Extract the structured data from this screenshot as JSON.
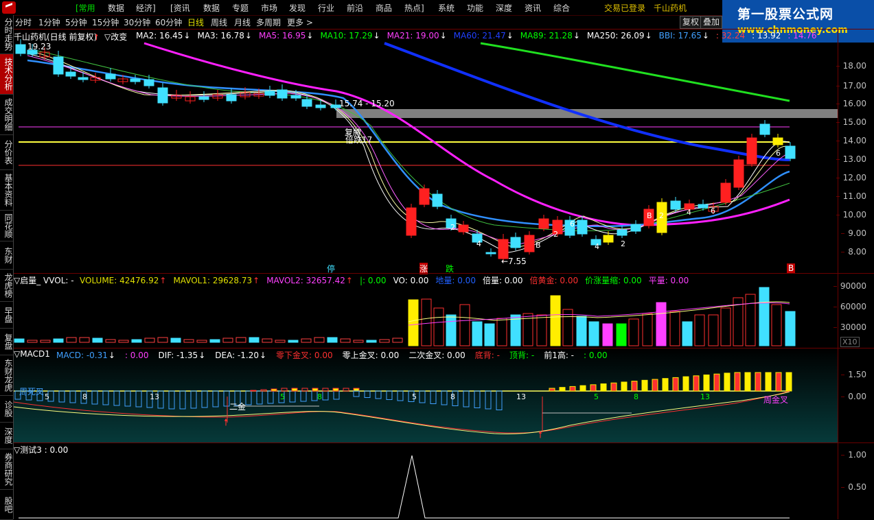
{
  "menubar": {
    "items": [
      "[常用",
      "数据",
      "经济]",
      "[资讯",
      "数据",
      "专题",
      "市场",
      "发现",
      "行业",
      "前沿",
      "商品",
      "热点]",
      "系统",
      "功能",
      "深度",
      "资讯",
      "综合"
    ],
    "status": "交易已登录",
    "stock": "千山药机"
  },
  "watermark": {
    "line1": "第一股票公式网",
    "line2": "www.chnmoney.com"
  },
  "toolbar": {
    "periods": [
      "分时",
      "1分钟",
      "5分钟",
      "15分钟",
      "30分钟",
      "60分钟",
      "日线",
      "周线",
      "月线",
      "多周期",
      "更多 >"
    ],
    "active_period": "日线",
    "btn_restore": "复权",
    "btn_overlay": "叠加"
  },
  "left_tabs": [
    "分时走势",
    "技术分析",
    "成交明细",
    "分价表",
    "基本资料",
    "同花顺",
    "东财",
    "龙虎榜",
    "早盘",
    "复盘",
    "东财龙虎",
    "诊股",
    "深度",
    "券商研究",
    "股吧"
  ],
  "left_tab_active": "技术分析",
  "main_chart": {
    "title": "千山药机(日线 前复权)",
    "mode": "▽改变",
    "ma": [
      {
        "label": "MA2: 16.45",
        "color": "#ffffff",
        "arrow": "↓"
      },
      {
        "label": "MA3: 16.78",
        "color": "#ffffff",
        "arrow": "↓"
      },
      {
        "label": "MA5: 16.95",
        "color": "#ff40ff",
        "arrow": "↓"
      },
      {
        "label": "MA10: 17.29",
        "color": "#00ff00",
        "arrow": "↓"
      },
      {
        "label": "MA21: 19.00",
        "color": "#ff40ff",
        "arrow": "↓"
      },
      {
        "label": "MA60: 21.47",
        "color": "#2040ff",
        "arrow": "↓"
      },
      {
        "label": "MA89: 21.28",
        "color": "#00ff00",
        "arrow": "↓"
      },
      {
        "label": "MA250: 26.09",
        "color": "#ffffff",
        "arrow": "↓"
      },
      {
        "label": "BBI: 17.65",
        "color": "#40a0ff",
        "arrow": "↓"
      },
      {
        "label": ": 32.24",
        "color": "#ff4040",
        "arrow": ""
      },
      {
        "label": ": 13.92",
        "color": "#ffffff",
        "arrow": ""
      },
      {
        "label": ": 14.76",
        "color": "#ff40ff",
        "arrow": ""
      }
    ],
    "y_ticks": [
      "18.00",
      "17.00",
      "16.00",
      "15.00",
      "14.00",
      "13.00",
      "12.00",
      "11.00",
      "10.00",
      "9.00",
      "8.00"
    ],
    "ann_high": "19.23",
    "ann_range": "15.74 - 15.20",
    "ann_resume": "复牌",
    "ann_bei": "倍跌17",
    "ann_low": "←7.55",
    "bottom_tags": [
      {
        "text": "停",
        "color": "#40e0ff"
      },
      {
        "text": "涨",
        "color": "#ffffff"
      },
      {
        "text": "跌",
        "color": "#00ff00"
      },
      {
        "text": "B",
        "color": "#ffffff"
      }
    ],
    "candle_nums": [
      "2",
      "4",
      "6",
      "2",
      "B",
      "2",
      "4",
      "6",
      "B",
      "2",
      "4",
      "6",
      "2",
      "2"
    ]
  },
  "volume_panel": {
    "title": "▽启量_ VVOL: -",
    "fields": [
      {
        "label": "VOLUME: 42476.92",
        "color": "#e0e000",
        "arrow": "↑"
      },
      {
        "label": "MAVOL1: 29628.73",
        "color": "#e0e000",
        "arrow": "↑"
      },
      {
        "label": "MAVOL2: 32657.42",
        "color": "#ff40ff",
        "arrow": "↑"
      },
      {
        "label": "|: 0.00",
        "color": "#00ff00",
        "arrow": ""
      },
      {
        "label": "VO: 0.00",
        "color": "#ffffff",
        "arrow": ""
      },
      {
        "label": "地量: 0.00",
        "color": "#2060ff",
        "arrow": ""
      },
      {
        "label": "倍量: 0.00",
        "color": "#ffffff",
        "arrow": ""
      },
      {
        "label": "倍黄金: 0.00",
        "color": "#ff3030",
        "arrow": ""
      },
      {
        "label": "价涨量缩: 0.00",
        "color": "#00ff00",
        "arrow": ""
      },
      {
        "label": "平量: 0.00",
        "color": "#ff40ff",
        "arrow": ""
      }
    ],
    "y_ticks": [
      "90000",
      "60000",
      "30000"
    ],
    "scale": "X10"
  },
  "macd_panel": {
    "title": "▽MACD1",
    "fields": [
      {
        "label": "MACD: -0.31",
        "color": "#40a0ff",
        "arrow": "↓"
      },
      {
        "label": ": 0.00",
        "color": "#ff40ff",
        "arrow": ""
      },
      {
        "label": "DIF: -1.35",
        "color": "#ffffff",
        "arrow": "↓"
      },
      {
        "label": "DEA: -1.20",
        "color": "#ffffff",
        "arrow": "↓"
      },
      {
        "label": "零下金叉: 0.00",
        "color": "#ff3030",
        "arrow": ""
      },
      {
        "label": "零上金叉: 0.00",
        "color": "#ffffff",
        "arrow": ""
      },
      {
        "label": "二次金叉: 0.00",
        "color": "#ffffff",
        "arrow": ""
      },
      {
        "label": "底背: -",
        "color": "#ff3030",
        "arrow": ""
      },
      {
        "label": "顶背: -",
        "color": "#00ff00",
        "arrow": ""
      },
      {
        "label": "前1高: -",
        "color": "#ffffff",
        "arrow": ""
      },
      {
        "label": ": 0.00",
        "color": "#00ff00",
        "arrow": ""
      }
    ],
    "y_ticks": [
      "1.50",
      "0.00"
    ],
    "ann_week_death": "周死叉",
    "ann_second_gold": "二金",
    "ann_week_gold": "周金叉",
    "counts": [
      "5",
      "8",
      "13",
      "5",
      "8",
      "5",
      "8",
      "13",
      "5",
      "8",
      "13"
    ]
  },
  "test_panel": {
    "title": "▽测试3 : 0.00",
    "y_ticks": [
      "1.00",
      "0.50"
    ]
  }
}
